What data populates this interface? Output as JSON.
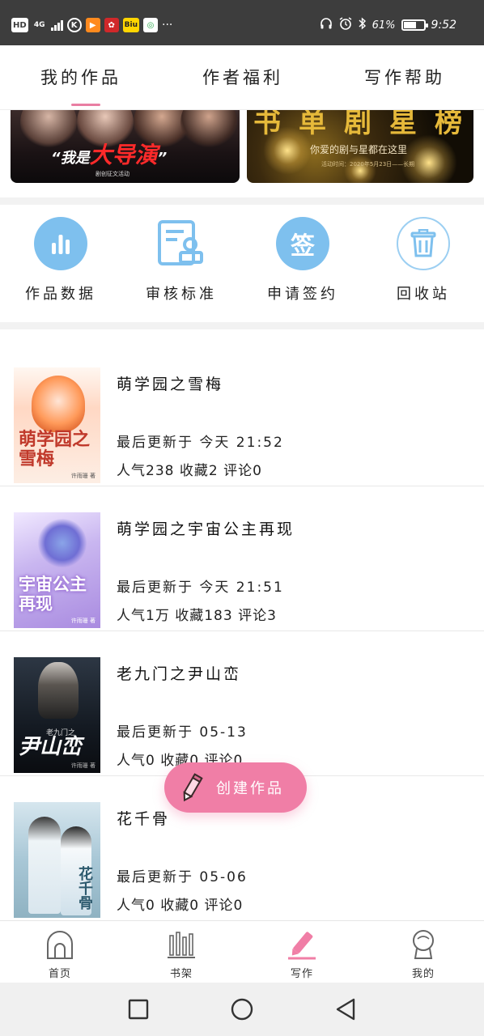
{
  "status_bar": {
    "left_icons": [
      "HD",
      "4G",
      "signal-icon",
      "K",
      "play-icon",
      "app-red-icon",
      "Biu",
      "app-green-icon",
      "···"
    ],
    "hd": "HD",
    "network": "4G",
    "biu": "Biu",
    "dots": "···",
    "battery_percent": "61%",
    "battery_level": 0.61,
    "time": "9:52"
  },
  "tabs": {
    "my_works": "我的作品",
    "author_benefits": "作者福利",
    "writing_help": "写作帮助",
    "active_index": 0
  },
  "banners": {
    "left": {
      "quote_text": "“我是",
      "big_text": "大导演",
      "close_quote": "”",
      "sub_text": "剧创征文活动"
    },
    "right": {
      "gold_text": "书单剧星榜",
      "tagline": "你爱的剧与星都在这里",
      "date": "活动时间：2020年5月23日——长期"
    }
  },
  "actions": [
    {
      "label": "作品数据",
      "icon": "bar-chart-icon"
    },
    {
      "label": "审核标准",
      "icon": "review-document-icon"
    },
    {
      "label": "申请签约",
      "icon": "sign-contract-icon",
      "icon_text": "签"
    },
    {
      "label": "回收站",
      "icon": "trash-icon"
    }
  ],
  "works": [
    {
      "title": "萌学园之雪梅",
      "updated": "最后更新于 今天 21:52",
      "stats": "人气238 收藏2 评论0",
      "cover_title": "萌学园之雪梅",
      "cover_author": "许雨珊 著"
    },
    {
      "title": "萌学园之宇宙公主再现",
      "updated": "最后更新于 今天 21:51",
      "stats": "人气1万 收藏183 评论3",
      "cover_title": "宇宙公主再现",
      "cover_author": "许雨珊 著"
    },
    {
      "title": "老九门之尹山峦",
      "updated": "最后更新于 05-13",
      "stats": "人气0 收藏0 评论0",
      "cover_title": "尹山峦",
      "cover_subtitle": "老九门之",
      "cover_author": "许雨珊 著"
    },
    {
      "title": "花千骨",
      "updated": "最后更新于 05-06",
      "stats": "人气0 收藏0 评论0",
      "cover_title": "花千骨"
    }
  ],
  "fab": {
    "label": "创建作品"
  },
  "bottom_nav": [
    {
      "label": "首页",
      "icon": "home-icon"
    },
    {
      "label": "书架",
      "icon": "bookshelf-icon"
    },
    {
      "label": "写作",
      "icon": "pencil-icon",
      "active": true
    },
    {
      "label": "我的",
      "icon": "profile-icon"
    }
  ],
  "colors": {
    "accent_pink": "#f07ea6",
    "icon_blue": "#7ec0ee",
    "status_bar_bg": "#3d3d3d"
  }
}
